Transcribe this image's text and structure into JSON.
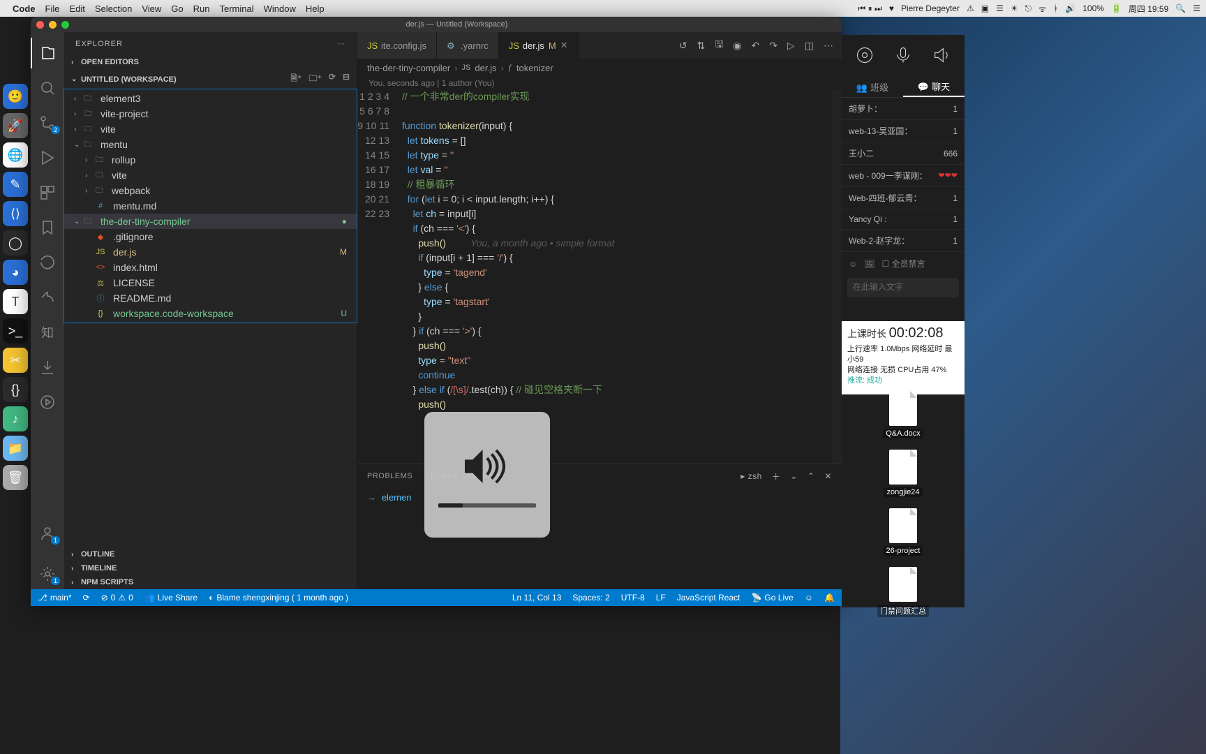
{
  "mac_menu": {
    "apple": "",
    "app": "Code",
    "items": [
      "File",
      "Edit",
      "Selection",
      "View",
      "Go",
      "Run",
      "Terminal",
      "Window",
      "Help"
    ],
    "user": "Pierre Degeyter",
    "battery": "100%",
    "datetime": "周四 19:59"
  },
  "window_title": "der.js — Untitled (Workspace)",
  "explorer": {
    "title": "EXPLORER",
    "sections": {
      "open_editors": "OPEN EDITORS",
      "workspace": "UNTITLED (WORKSPACE)",
      "outline": "OUTLINE",
      "timeline": "TIMELINE",
      "npm": "NPM SCRIPTS"
    },
    "tree": {
      "element3": "element3",
      "vite_project": "vite-project",
      "vite": "vite",
      "mentu": "mentu",
      "rollup": "rollup",
      "vite2": "vite",
      "webpack": "webpack",
      "mentu_md": "mentu.md",
      "compiler": "the-der-tiny-compiler",
      "gitignore": ".gitignore",
      "der_js": "der.js",
      "der_js_status": "M",
      "index_html": "index.html",
      "license": "LICENSE",
      "readme": "README.md",
      "workspace_file": "workspace.code-workspace",
      "workspace_status": "U"
    }
  },
  "tabs": {
    "t1": "ite.config.js",
    "t2": ".yarnrc",
    "t3": "der.js",
    "t3_status": "M"
  },
  "breadcrumb": {
    "p1": "the-der-tiny-compiler",
    "p2": "der.js",
    "p3": "tokenizer"
  },
  "blame_line": "You, seconds ago | 1 author (You)",
  "code": {
    "l1_comment": "// 一个非常der的compiler实现",
    "l3_kw": "function",
    "l3_fn": "tokenizer",
    "l3_rest": "(input) {",
    "l4_kw": "let",
    "l4_var": "tokens",
    "l4_rest": " = []",
    "l5_kw": "let",
    "l5_var": "type",
    "l5_str": "''",
    "l6_kw": "let",
    "l6_var": "val",
    "l6_str": "''",
    "l7_comment": "// 粗暴循环",
    "l8_kw1": "for",
    "l8_kw2": "let",
    "l8_rest": " i = 0; i < input.length; i++) {",
    "l9_kw": "let",
    "l9_var": "ch",
    "l9_rest": " = input[i]",
    "l10_kw": "if",
    "l10_rest": " (ch === ",
    "l10_str": "'<'",
    "l10_end": ") {",
    "l11": "push()",
    "l11_dim": "You, a month ago • simple format",
    "l12_kw": "if",
    "l12_rest": " (input[i + 1] === ",
    "l12_str": "'/'",
    "l12_end": ") {",
    "l13_var": "type",
    "l13_rest": " = ",
    "l13_str": "'tagend'",
    "l14_kw": "else",
    "l15_var": "type",
    "l15_rest": " = ",
    "l15_str": "'tagstart'",
    "l17_kw": "if",
    "l17_rest": " (ch === ",
    "l17_str": "'>'",
    "l17_end": ") {",
    "l18": "push()",
    "l19_var": "type",
    "l19_rest": " = ",
    "l19_str": "\"text\"",
    "l20_kw": "continue",
    "l21_kw": "else if",
    "l21_rest": " (",
    "l21_re": "/[\\s]/",
    "l21_rest2": ".test(ch)) { ",
    "l21_com": "// 碰见空格夹断一下",
    "l22": "push()"
  },
  "panel": {
    "problems": "PROBLEMS",
    "debug": "DEBUG CONSOLE",
    "shell": "zsh",
    "prompt_cmd": "elemen"
  },
  "status": {
    "branch": "main*",
    "errors": "0",
    "warnings": "0",
    "liveshare": "Live Share",
    "blame": "Blame shengxinjing ( 1 month ago )",
    "cursor": "Ln 11, Col 13",
    "spaces": "Spaces: 2",
    "enc": "UTF-8",
    "eol": "LF",
    "lang": "JavaScript React",
    "golive": "Go Live"
  },
  "right_panel": {
    "tab1": "班级",
    "tab2": "聊天",
    "rows": [
      {
        "name": "胡萝卜：",
        "msg": "1"
      },
      {
        "name": "web-13-吴亚国：",
        "msg": "1"
      },
      {
        "name": "王小二",
        "msg": "666"
      },
      {
        "name": "web - 009一李谋刚：",
        "hearts": "❤❤❤"
      },
      {
        "name": "Web-四班-郁云青：",
        "msg": "1"
      },
      {
        "name": "Yancy Qi :",
        "msg": "1"
      },
      {
        "name": "Web-2-赵字龙：",
        "msg": "1"
      }
    ],
    "mute": "全员禁言",
    "placeholder": "在此输入文字"
  },
  "meeting": {
    "title": "上课时长",
    "time": "00:02:08",
    "l1a": "上行速率",
    "l1b": "1.0Mbps",
    "l1c": "网络延时",
    "l1d": "最小59",
    "l2a": "网络连接",
    "l2b": "无损",
    "l2c": "CPU占用",
    "l2d": "47%",
    "l3": "推流: 成功"
  },
  "desk_files": {
    "f1": "Q&A.docx",
    "f2": "zongjie24",
    "f3": "26-project",
    "f4": "门禁问题汇总"
  },
  "activity_badges": {
    "scm": "2",
    "account": "1",
    "gear": "1"
  }
}
